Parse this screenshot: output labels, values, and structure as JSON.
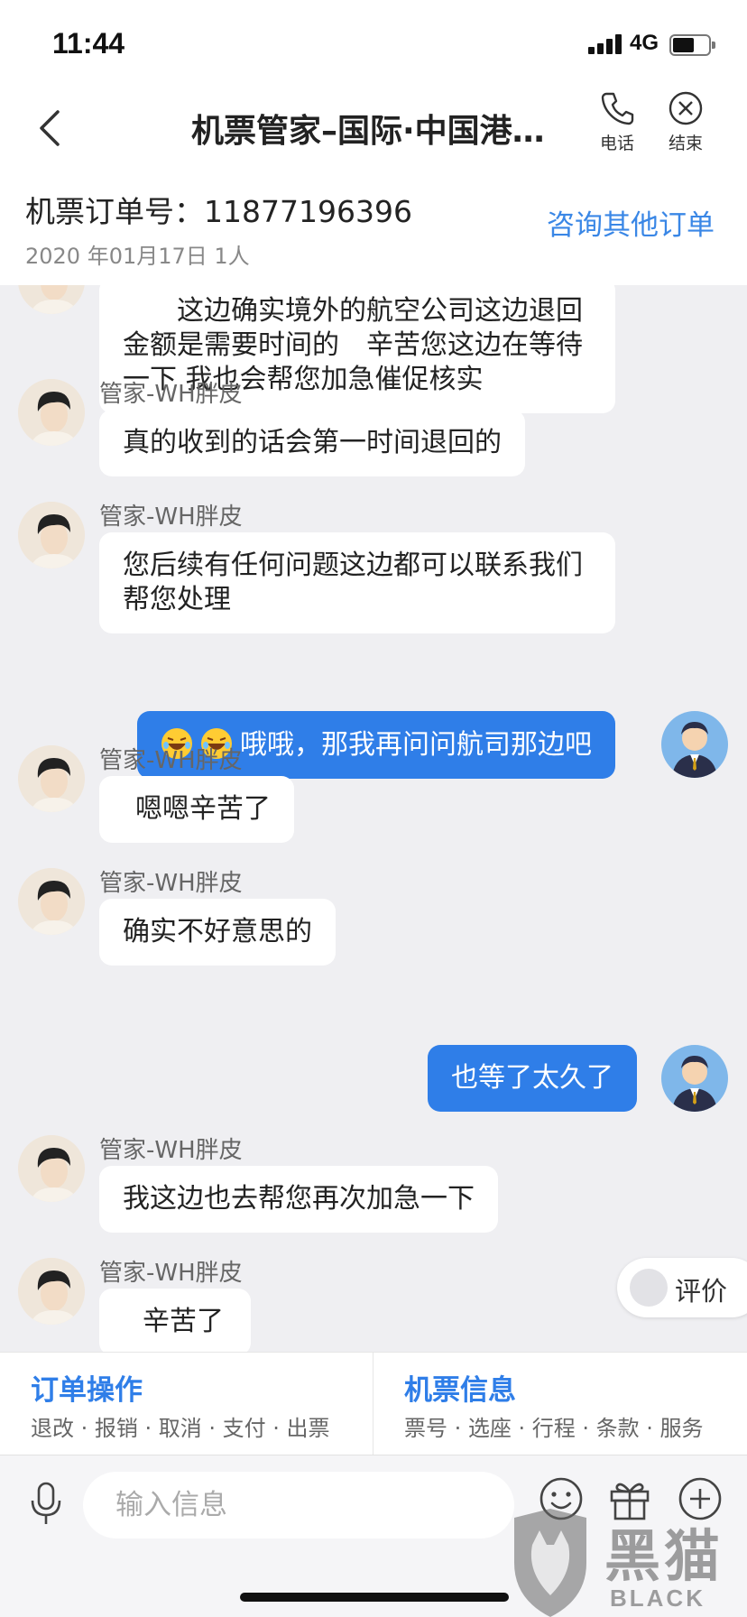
{
  "status": {
    "time": "11:44",
    "network": "4G",
    "battery_level": 0.6
  },
  "nav": {
    "title": "机票管家–国际·中国港…",
    "phone_label": "电话",
    "end_label": "结束"
  },
  "order": {
    "number_label": "机票订单号：11877196396",
    "meta": "2020 年01月17日 1人",
    "other_orders_link": "咨询其他订单"
  },
  "chat": {
    "messages": [
      {
        "from": "agent",
        "sender": "",
        "text": "　　这边确实境外的航空公司这边退回金额是需要时间的　辛苦您这边在等待一下 我也会帮您加急催促核实"
      },
      {
        "from": "agent",
        "sender": "管家-WH胖皮",
        "text": "真的收到的话会第一时间退回的"
      },
      {
        "from": "agent",
        "sender": "管家-WH胖皮",
        "text": "您后续有任何问题这边都可以联系我们帮您处理"
      },
      {
        "from": "user",
        "sender": "",
        "text": "哦哦，那我再问问航司那边吧"
      },
      {
        "from": "agent",
        "sender": "管家-WH胖皮",
        "text": "嗯嗯辛苦了"
      },
      {
        "from": "agent",
        "sender": "管家-WH胖皮",
        "text": "确实不好意思的"
      },
      {
        "from": "user",
        "sender": "",
        "text": "也等了太久了"
      },
      {
        "from": "agent",
        "sender": "管家-WH胖皮",
        "text": "我这边也去帮您再次加急一下"
      },
      {
        "from": "agent",
        "sender": "管家-WH胖皮",
        "text": "辛苦了"
      }
    ],
    "rate_button": "评价"
  },
  "panels": {
    "order_ops": {
      "title": "订单操作",
      "items": "退改 · 报销 · 取消 · 支付 · 出票"
    },
    "ticket_info": {
      "title": "机票信息",
      "items": "票号 · 选座 · 行程 · 条款 · 服务"
    }
  },
  "input": {
    "placeholder": "输入信息"
  },
  "watermark": {
    "cn": "黑猫",
    "en": "BLACK CAT"
  },
  "colors": {
    "accent": "#2f7ee8",
    "link": "#3a87e6",
    "chat_bg": "#efeff2"
  },
  "icons": [
    "back-icon",
    "phone-icon",
    "close-icon",
    "mic-icon",
    "emoji-icon",
    "gift-icon",
    "plus-icon"
  ]
}
